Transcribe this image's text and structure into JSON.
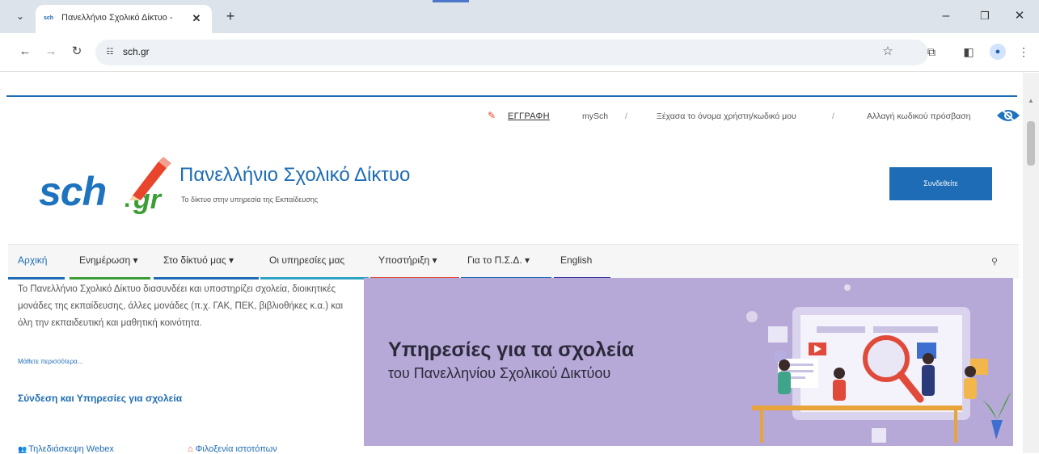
{
  "browser": {
    "tab_title": "Πανελλήνιο Σχολικό Δίκτυο -",
    "favicon_text": "sch",
    "url": "sch.gr",
    "icons": {
      "tab_search": "chevron-down-icon",
      "close_tab": "close-icon",
      "new_tab": "plus-icon",
      "back": "back-arrow-icon",
      "forward": "forward-arrow-icon",
      "reload": "reload-icon",
      "site_info": "site-info-icon",
      "bookmark": "star-icon",
      "extensions": "puzzle-icon",
      "side_panel": "side-panel-icon",
      "profile": "profile-icon",
      "menu": "kebab-menu-icon",
      "minimize": "minimize-icon",
      "maximize": "restore-icon",
      "close_window": "close-window-icon"
    }
  },
  "utility": {
    "register": "ΕΓΓΡΑΦΗ",
    "mysch": "mySch",
    "forgot": "Ξέχασα το όνομα χρήστη/κωδικό μου",
    "change_pw": "Αλλαγή κωδικού πρόσβαση",
    "separator": "/"
  },
  "header": {
    "logo_main": "sch",
    "logo_dot": ".",
    "logo_suffix": "gr",
    "title": "Πανελλήνιο Σχολικό Δίκτυο",
    "subtitle": "Το δίκτυο στην υπηρεσία της Εκπαίδευσης",
    "login_label": "Συνδεθείτε"
  },
  "nav": {
    "items": [
      {
        "label": "Αρχική"
      },
      {
        "label": "Ενημέρωση ▾"
      },
      {
        "label": "Στο δίκτυό μας ▾"
      },
      {
        "label": "Οι υπηρεσίες μας"
      },
      {
        "label": "Υποστήριξη ▾"
      },
      {
        "label": "Για το Π.Σ.Δ. ▾"
      },
      {
        "label": "English"
      }
    ],
    "underline_colors": [
      "#1e6cb5",
      "#3a9d35",
      "#1e6cb5",
      "#2fa3c4",
      "#e04a3a",
      "#1e6cb5",
      "#3a3a9c"
    ]
  },
  "content": {
    "intro": "Το Πανελλήνιο Σχολικό Δίκτυο διασυνδέει και υποστηρίζει σχολεία, διοικητικές μονάδες της εκπαίδευσης, άλλες μονάδες (π.χ. ΓΑΚ, ΠΕΚ, βιβλιοθήκες κ.α.) και όλη την εκπαιδευτική και μαθητική κοινότητα.",
    "more": "Μάθετε περισσότερα...",
    "services_link": "Σύνδεση και Υπηρεσίες για σχολεία",
    "webex": "Τηλεδιάσκεψη Webex",
    "hosting": "Φιλοξενία ιστοτόπων"
  },
  "hero": {
    "title": "Υπηρεσίες για τα σχολεία",
    "subtitle": "του Πανελληνίου Σχολικού Δικτύου",
    "bg_color": "#b7a9d7"
  }
}
